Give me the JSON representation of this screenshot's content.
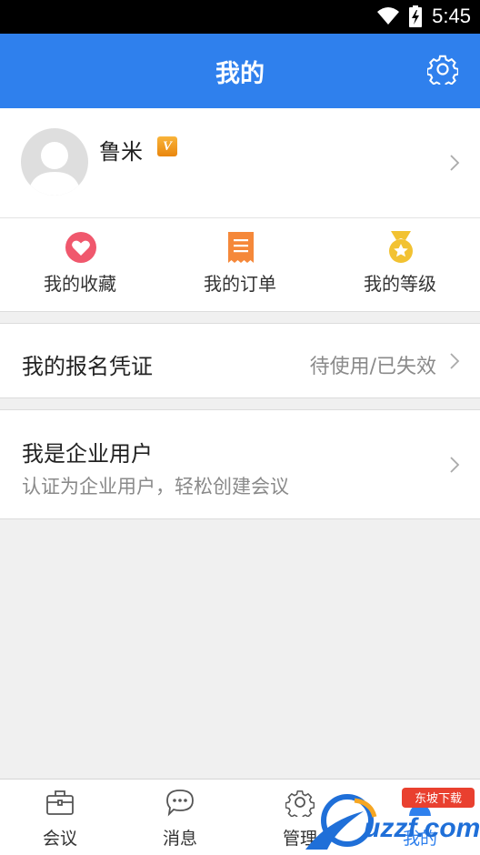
{
  "status_bar": {
    "time": "5:45"
  },
  "header": {
    "title": "我的"
  },
  "profile": {
    "name": "鲁米",
    "badge": "V"
  },
  "quick_links": [
    {
      "label": "我的收藏",
      "icon": "heart-icon",
      "color": "#f0586d"
    },
    {
      "label": "我的订单",
      "icon": "receipt-icon",
      "color": "#f5883a"
    },
    {
      "label": "我的等级",
      "icon": "medal-icon",
      "color": "#f2c232"
    }
  ],
  "ticket_row": {
    "title": "我的报名凭证",
    "status": "待使用/已失效"
  },
  "enterprise_row": {
    "title": "我是企业用户",
    "subtitle": "认证为企业用户，轻松创建会议"
  },
  "tabs": [
    {
      "label": "会议",
      "icon": "briefcase-icon"
    },
    {
      "label": "消息",
      "icon": "chat-icon"
    },
    {
      "label": "管理",
      "icon": "gear-icon"
    },
    {
      "label": "我的",
      "icon": "person-icon",
      "active": true
    }
  ],
  "watermark": {
    "text": "uzzf.com",
    "tag": "东坡下载"
  },
  "colors": {
    "primary": "#2f80ed",
    "background": "#f0f0f0"
  }
}
